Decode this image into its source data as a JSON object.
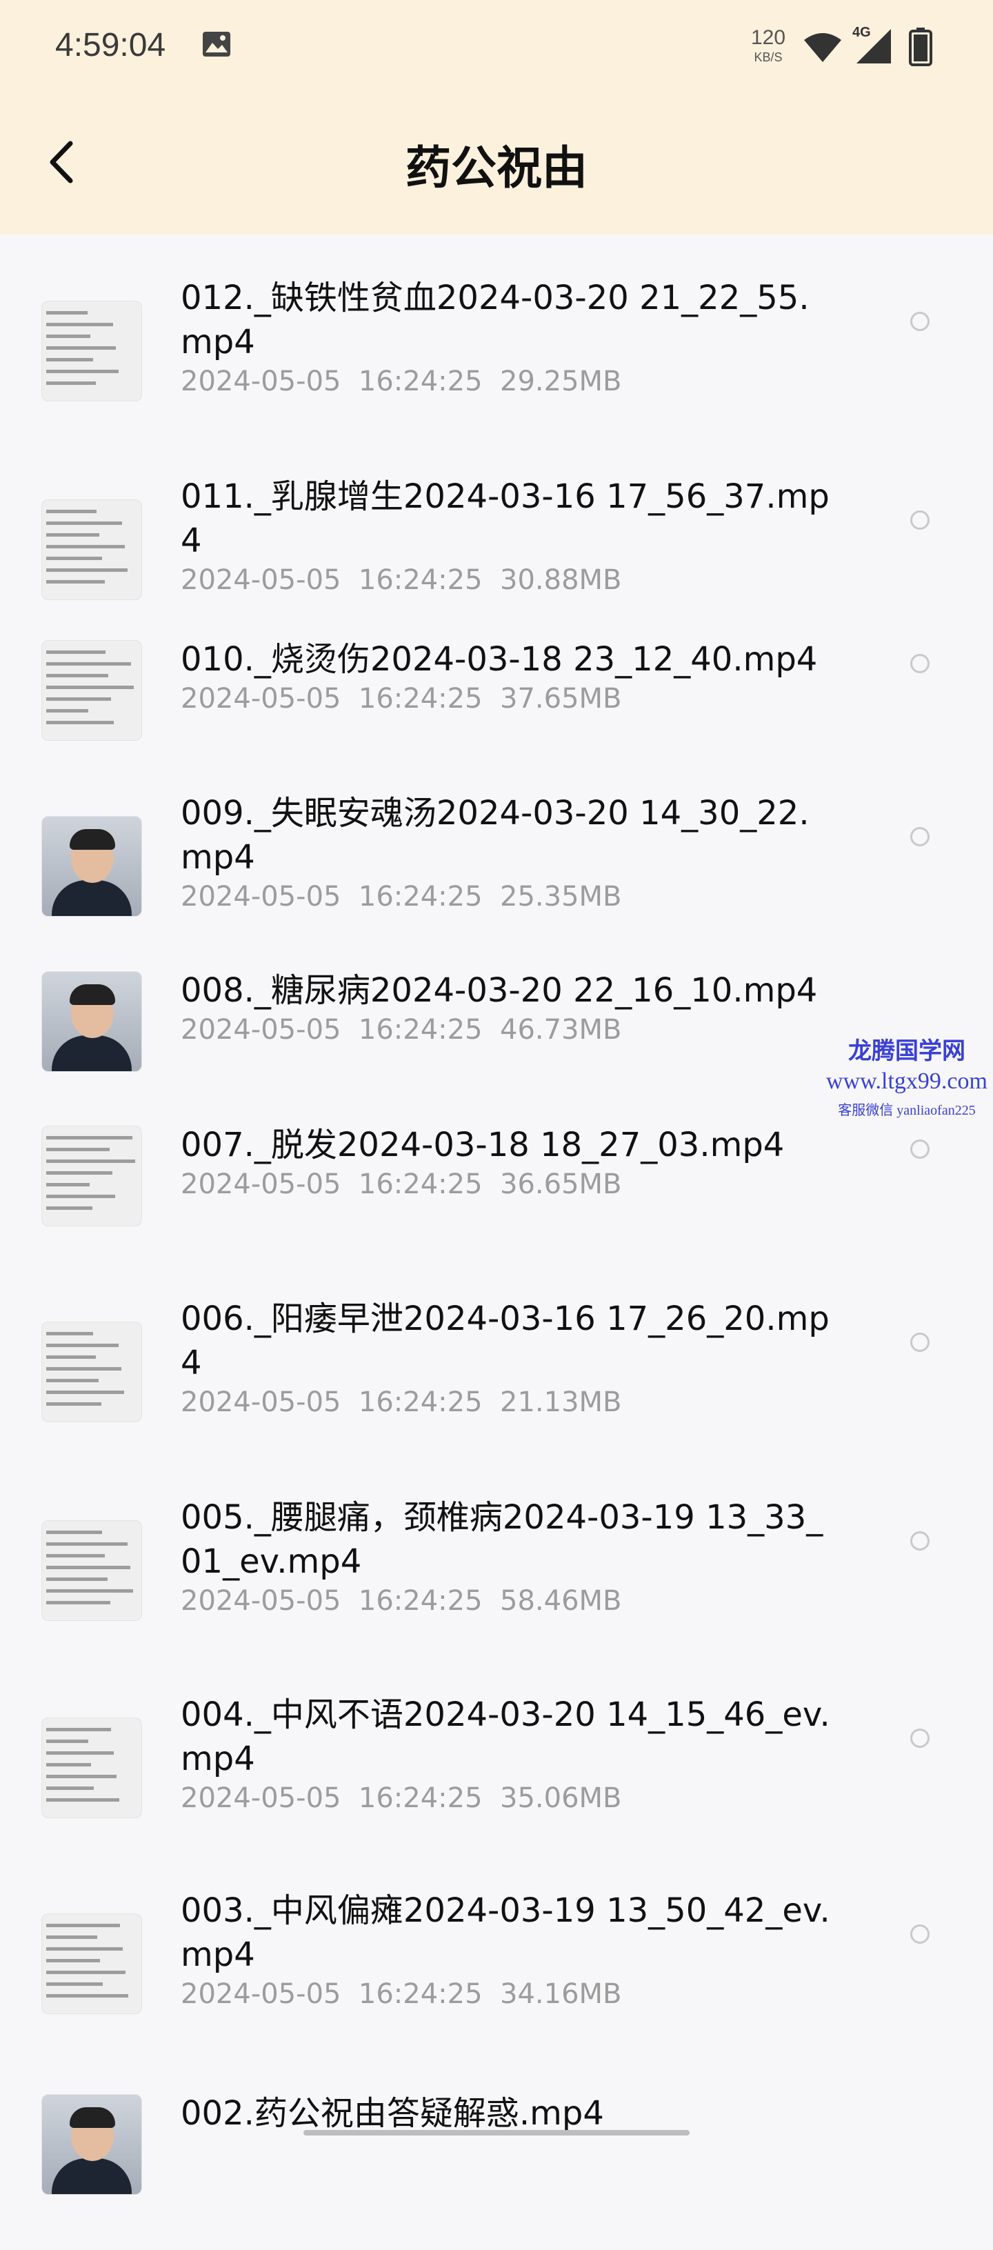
{
  "status_bar": {
    "time": "4:59:04",
    "net_speed_value": "120",
    "net_speed_unit": "KB/S",
    "network": "4G",
    "icons": [
      "image-icon",
      "wifi-icon",
      "signal-icon",
      "battery-icon"
    ]
  },
  "header": {
    "title": "药公祝由",
    "back_icon": "chevron-left-icon",
    "background": "#fcf1dc"
  },
  "files": [
    {
      "name": "012._缺铁性贫血2024-03-20 21_22_55.mp4",
      "date": "2024-05-05",
      "time": "16:24:25",
      "size": "29.25MB",
      "thumb": "text"
    },
    {
      "name": "011._乳腺增生2024-03-16 17_56_37.mp4",
      "date": "2024-05-05",
      "time": "16:24:25",
      "size": "30.88MB",
      "thumb": "text"
    },
    {
      "name": "010._烧烫伤2024-03-18 23_12_40.mp4",
      "date": "2024-05-05",
      "time": "16:24:25",
      "size": "37.65MB",
      "thumb": "text"
    },
    {
      "name": "009._失眠安魂汤2024-03-20 14_30_22.mp4",
      "date": "2024-05-05",
      "time": "16:24:25",
      "size": "25.35MB",
      "thumb": "face"
    },
    {
      "name": "008._糖尿病2024-03-20 22_16_10.mp4",
      "date": "2024-05-05",
      "time": "16:24:25",
      "size": "46.73MB",
      "thumb": "face"
    },
    {
      "name": "007._脱发2024-03-18 18_27_03.mp4",
      "date": "2024-05-05",
      "time": "16:24:25",
      "size": "36.65MB",
      "thumb": "text"
    },
    {
      "name": "006._阳痿早泄2024-03-16 17_26_20.mp4",
      "date": "2024-05-05",
      "time": "16:24:25",
      "size": "21.13MB",
      "thumb": "text"
    },
    {
      "name": "005._腰腿痛，颈椎病2024-03-19 13_33_01_ev.mp4",
      "date": "2024-05-05",
      "time": "16:24:25",
      "size": "58.46MB",
      "thumb": "text"
    },
    {
      "name": "004._中风不语2024-03-20 14_15_46_ev.mp4",
      "date": "2024-05-05",
      "time": "16:24:25",
      "size": "35.06MB",
      "thumb": "text"
    },
    {
      "name": "003._中风偏瘫2024-03-19 13_50_42_ev.mp4",
      "date": "2024-05-05",
      "time": "16:24:25",
      "size": "34.16MB",
      "thumb": "text"
    },
    {
      "name": "002.药公祝由答疑解惑.mp4",
      "date": "",
      "time": "",
      "size": "",
      "thumb": "face"
    }
  ],
  "watermark": {
    "line1": "龙腾国学网",
    "line2": "www.ltgx99.com",
    "line3": "客服微信 yanliaofan225"
  }
}
